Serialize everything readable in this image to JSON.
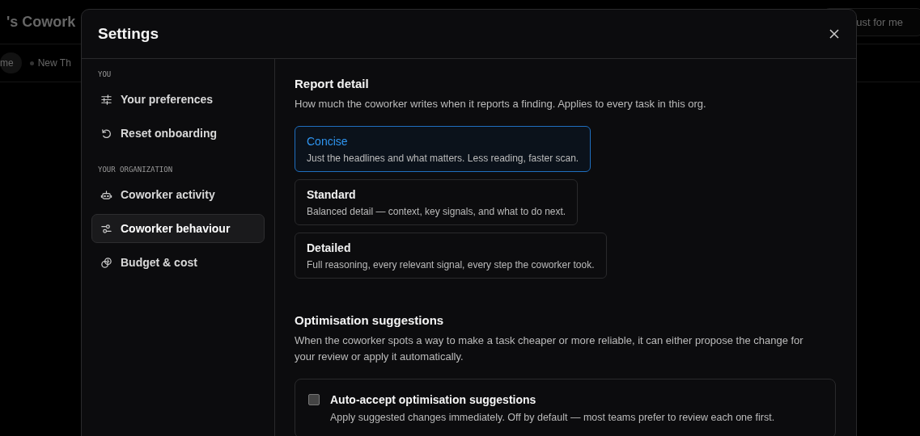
{
  "background": {
    "title": "'s Cowork",
    "pills": [
      {
        "label": "me",
        "selected": true
      },
      {
        "label": "New Th",
        "selected": false
      }
    ],
    "right_button": "ust for me"
  },
  "dialog": {
    "title": "Settings",
    "sidebar": [
      {
        "heading": "YOU",
        "items": [
          {
            "label": "Your preferences",
            "selected": false
          },
          {
            "label": "Reset onboarding",
            "selected": false
          }
        ]
      },
      {
        "heading": "YOUR ORGANIZATION",
        "items": [
          {
            "label": "Coworker activity",
            "selected": false
          },
          {
            "label": "Coworker behaviour",
            "selected": true
          },
          {
            "label": "Budget & cost",
            "selected": false
          }
        ]
      }
    ],
    "report_detail": {
      "title": "Report detail",
      "description": "How much the coworker writes when it reports a finding. Applies to every task in this org.",
      "options": [
        {
          "label": "Concise",
          "description": "Just the headlines and what matters. Less reading, faster scan.",
          "selected": true
        },
        {
          "label": "Standard",
          "description": "Balanced detail — context, key signals, and what to do next.",
          "selected": false
        },
        {
          "label": "Detailed",
          "description": "Full reasoning, every relevant signal, every step the coworker took.",
          "selected": false
        }
      ]
    },
    "optimisation": {
      "title": "Optimisation suggestions",
      "description": "When the coworker spots a way to make a task cheaper or more reliable, it can either propose the change for your review or apply it automatically.",
      "setting": {
        "label": "Auto-accept optimisation suggestions",
        "description": "Apply suggested changes immediately. Off by default — most teams prefer to review each one first.",
        "checked": false
      }
    }
  }
}
